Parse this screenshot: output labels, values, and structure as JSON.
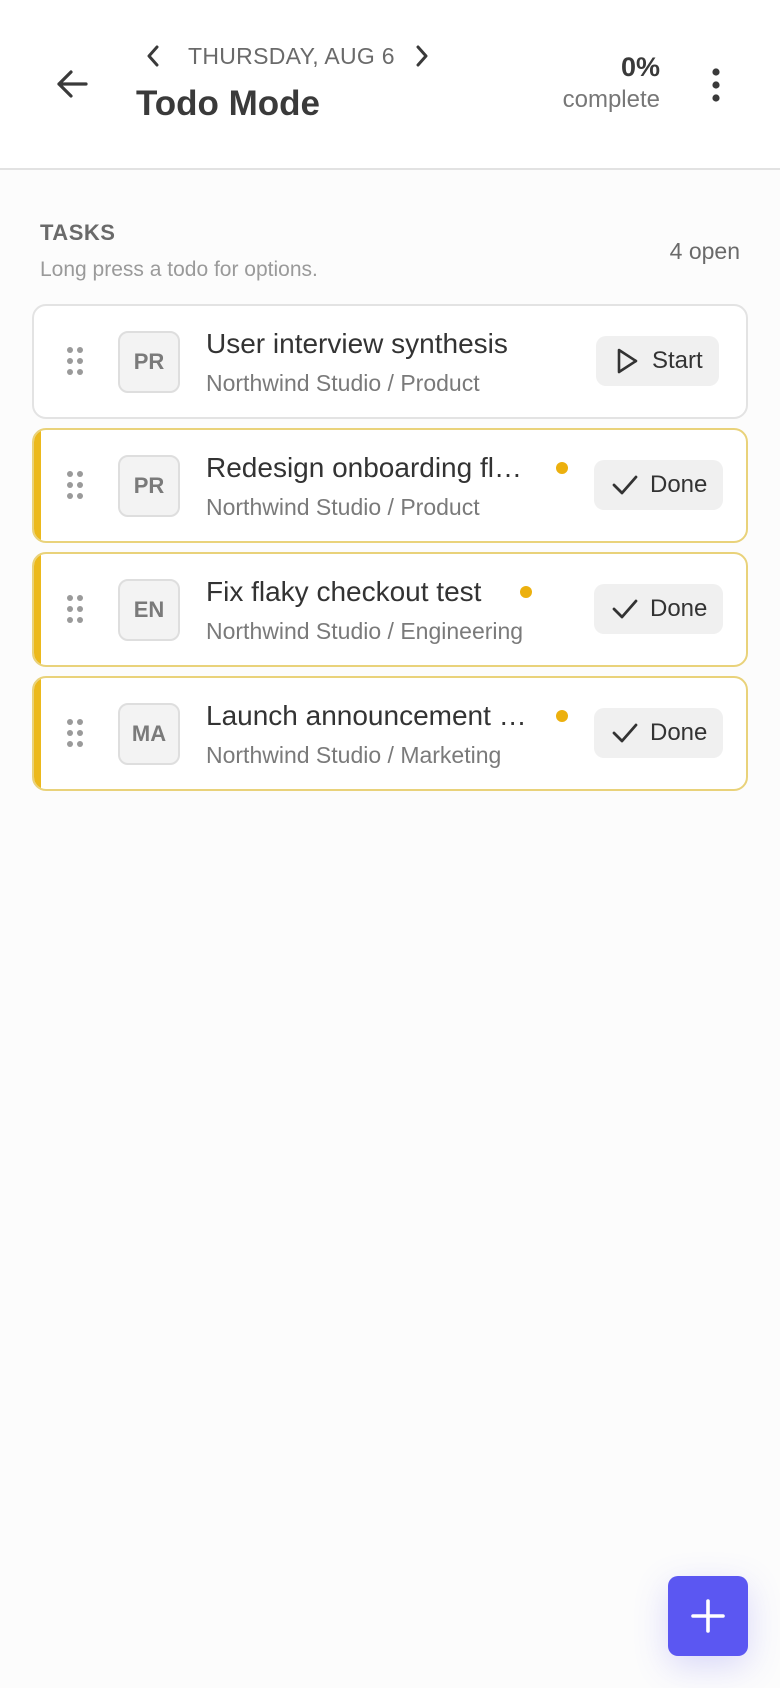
{
  "header": {
    "date": "THURSDAY, AUG 6",
    "title": "Todo Mode",
    "progress_value": "0%",
    "progress_label": "complete"
  },
  "section": {
    "title": "TASKS",
    "hint": "Long press a todo for options.",
    "open_count": "4 open"
  },
  "tasks": [
    {
      "avatar": "PR",
      "name": "User interview synthesis",
      "sub": "Northwind Studio / Product",
      "action": "Start",
      "action_icon": "play-icon",
      "active": false
    },
    {
      "avatar": "PR",
      "name": "Redesign onboarding fl…",
      "sub": "Northwind Studio / Product",
      "action": "Done",
      "action_icon": "check-icon",
      "active": true
    },
    {
      "avatar": "EN",
      "name": "Fix flaky checkout test",
      "sub": "Northwind Studio / Engineering",
      "action": "Done",
      "action_icon": "check-icon",
      "active": true
    },
    {
      "avatar": "MA",
      "name": "Launch announcement …",
      "sub": "Northwind Studio / Marketing",
      "action": "Done",
      "action_icon": "check-icon",
      "active": true
    }
  ],
  "colors": {
    "accent": "#5b57f2",
    "active_bar": "#ecb91c",
    "active_dot": "#ecb00e"
  },
  "icons": {
    "back": "arrow-left-icon",
    "prev": "chevron-left-icon",
    "next": "chevron-right-icon",
    "menu": "more-vertical-icon",
    "add": "plus-icon"
  }
}
